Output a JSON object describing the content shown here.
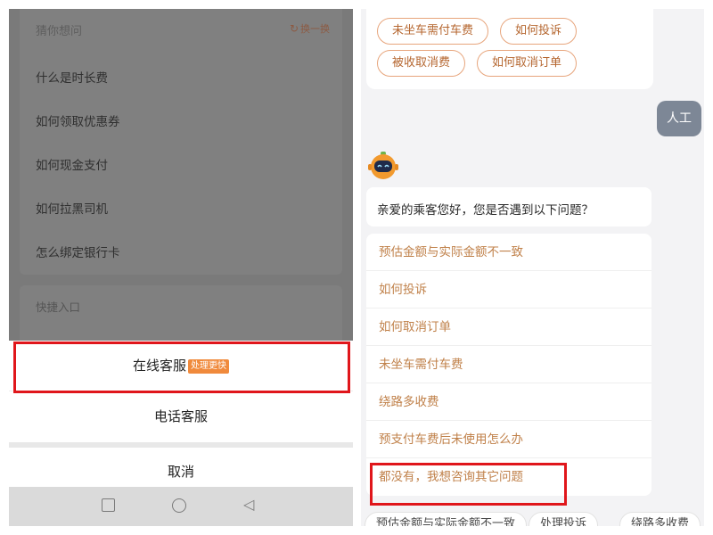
{
  "left_panel": {
    "guess_section": {
      "title": "猜你想问",
      "refresh_label": "换一换",
      "items": [
        "什么是时长费",
        "如何领取优惠券",
        "如何现金支付",
        "如何拉黑司机",
        "怎么绑定银行卡"
      ]
    },
    "shortcut_section": {
      "title": "快捷入口"
    },
    "action_sheet": {
      "online_service": "在线客服",
      "online_badge": "处理更快",
      "phone_service": "电话客服",
      "cancel": "取消"
    }
  },
  "right_panel": {
    "top_chips": [
      "未坐车需付车费",
      "如何投诉",
      "被收取消费",
      "如何取消订单"
    ],
    "human_button": "人工",
    "greeting": "亲爱的乘客您好，您是否遇到以下问题？",
    "options": [
      "预估金额与实际金额不一致",
      "如何投诉",
      "如何取消订单",
      "未坐车需付车费",
      "绕路多收费",
      "预支付车费后未使用怎么办",
      "都没有，我想咨询其它问题"
    ],
    "bottom_chips": [
      "预估金额与实际金额不一致",
      "处理投诉",
      "绕路多收费"
    ]
  },
  "colors": {
    "accent_orange": "#c0814a",
    "chip_border": "#e7a57c",
    "badge": "#f08a3c",
    "highlight_red": "#e0161b",
    "human_bubble": "#7d8796"
  },
  "icons": {
    "refresh": "refresh-icon",
    "nav": [
      "square-nav-icon",
      "circle-nav-icon",
      "back-triangle-icon"
    ],
    "bot": "robot-avatar-icon"
  }
}
